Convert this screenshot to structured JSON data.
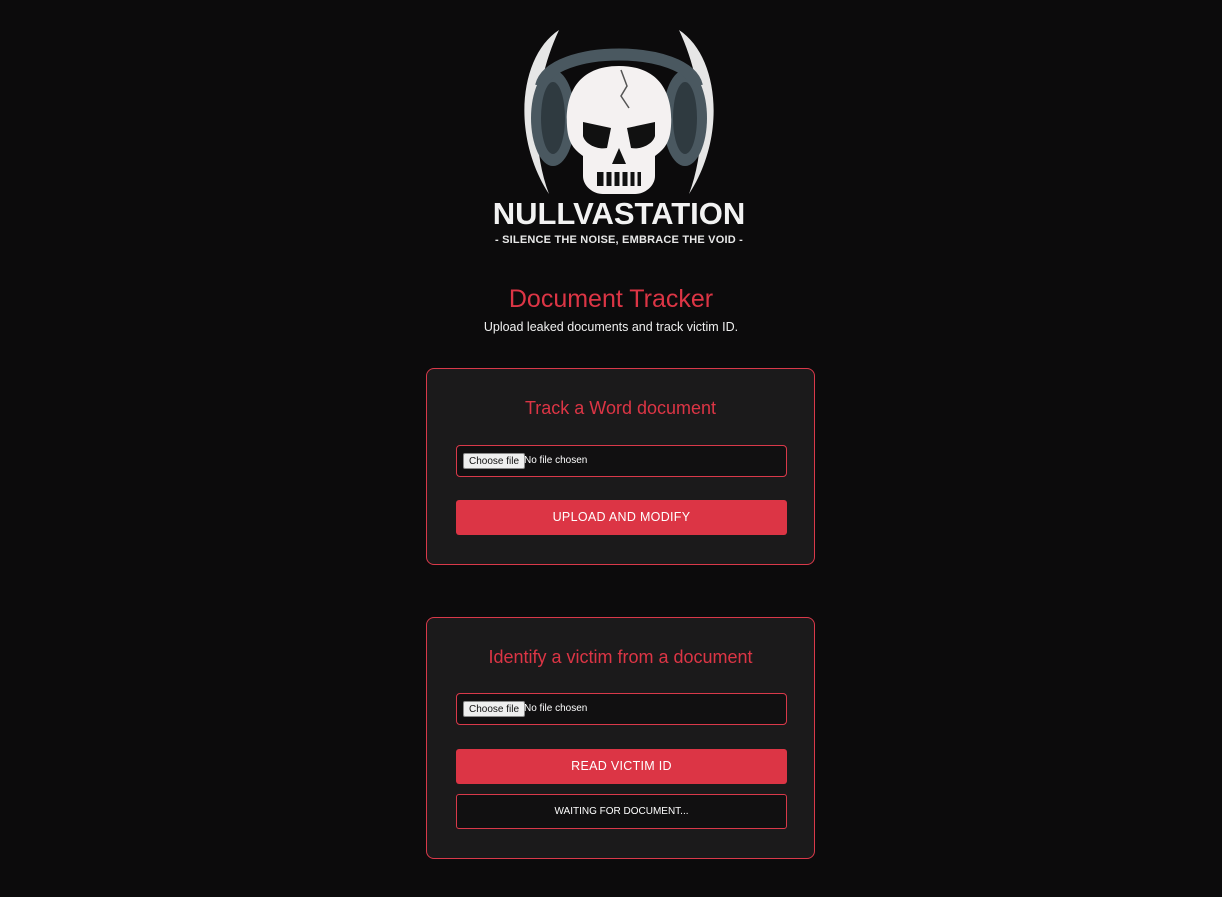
{
  "brand": {
    "name": "NULLVASTATION",
    "tagline": "- SILENCE THE NOISE, EMBRACE THE VOID -"
  },
  "header": {
    "title": "Document Tracker",
    "subtitle": "Upload leaked documents and track victim ID."
  },
  "track_card": {
    "title": "Track a Word document",
    "choose_file_label": "Choose file",
    "file_status": "No file chosen",
    "submit_label": "UPLOAD AND MODIFY"
  },
  "identify_card": {
    "title": "Identify a victim from a document",
    "choose_file_label": "Choose file",
    "file_status": "No file chosen",
    "submit_label": "READ VICTIM ID",
    "result_text": "WAITING FOR DOCUMENT..."
  },
  "colors": {
    "background": "#0c0b0c",
    "card": "#1b1a1b",
    "accent": "#dc3545"
  },
  "icons": [
    "skull-headphones-logo"
  ]
}
